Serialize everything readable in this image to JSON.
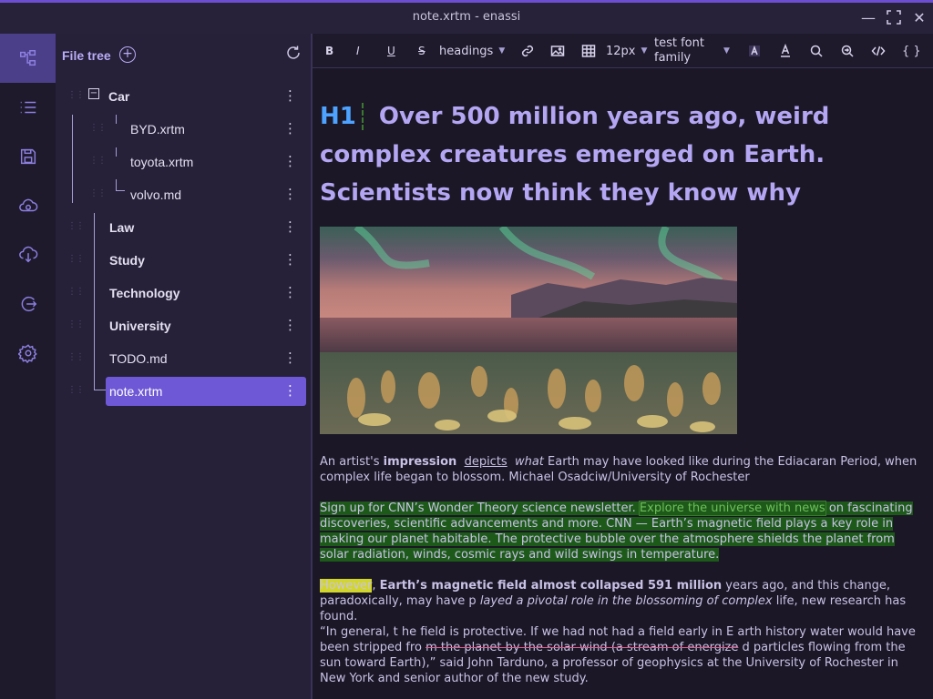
{
  "window": {
    "title": "note.xrtm - enassi"
  },
  "activity_bar": {
    "items": [
      {
        "name": "tree-view-icon",
        "active": true
      },
      {
        "name": "list-icon",
        "active": false
      },
      {
        "name": "save-icon",
        "active": false
      },
      {
        "name": "cloud-sync-icon",
        "active": false
      },
      {
        "name": "cloud-download-icon",
        "active": false
      },
      {
        "name": "logout-icon",
        "active": false
      },
      {
        "name": "settings-icon",
        "active": false
      }
    ]
  },
  "file_tree": {
    "title": "File tree",
    "items": [
      {
        "label": "Car",
        "bold": true,
        "level": 0,
        "expanded": true
      },
      {
        "label": "BYD.xrtm",
        "bold": false,
        "level": 1
      },
      {
        "label": "toyota.xrtm",
        "bold": false,
        "level": 1
      },
      {
        "label": "volvo.md",
        "bold": false,
        "level": 1
      },
      {
        "label": "Law",
        "bold": true,
        "level": 0
      },
      {
        "label": "Study",
        "bold": true,
        "level": 0
      },
      {
        "label": "Technology",
        "bold": true,
        "level": 0
      },
      {
        "label": "University",
        "bold": true,
        "level": 0
      },
      {
        "label": "TODO.md",
        "bold": false,
        "level": 0
      },
      {
        "label": "note.xrtm",
        "bold": false,
        "level": 0,
        "selected": true
      }
    ]
  },
  "toolbar": {
    "bold": "B",
    "italic": "I",
    "underline": "U",
    "strike": "S",
    "heading_select": "headings",
    "font_size": "12px",
    "font_family_1": "test font",
    "font_family_2": "family"
  },
  "document": {
    "h1_tag": "H1",
    "heading": "Over 500 million years ago, weird complex creatures emerged on Earth. Scientists now think they know why",
    "caption": {
      "p1": "An artist's ",
      "bold": "impression",
      "u": "depicts",
      "it": "what",
      "p2": " Earth may have looked like during the Ediacaran Period, when complex life began to blossom. Michael Osadciw/University of Rochester"
    },
    "para1": {
      "a": "Sign up for CNN’s Wonder Theory science newsletter. ",
      "b": "Explore the universe with news",
      "c": " on fascinating discoveries, scientific advancements and more. CNN — Earth’s magnetic field plays a key role in making our planet habitable. The protective bubble over the atmosphere shields the planet from solar radiation, winds, cosmic rays and wild swings in temperature."
    },
    "para2": {
      "hl": "However",
      "a": ", ",
      "bold": "Earth’s magnetic field almost collapsed 591 million",
      "b": " years ago, and this change, paradoxically, may have p ",
      "it": "layed a pivotal role in the blossoming of complex",
      "c": " life, new research has found."
    },
    "para3": {
      "a": "“In general, t he field is protective. If we had not had a field early in E arth history water would have been stripped fro ",
      "strike": "m the planet by the solar wind (a stream of energize",
      "b": " d particles flowing from the sun toward Earth),” said John Tarduno, a professor of geophysics at the University of Rochester in New York and senior author of the new study."
    }
  },
  "colors": {
    "accent": "#6f58d6",
    "heading": "#b4a6f2",
    "h1_tag": "#4da3ff",
    "highlight_green": "#1d5a1a",
    "highlight_yellow": "#d2d62a"
  }
}
